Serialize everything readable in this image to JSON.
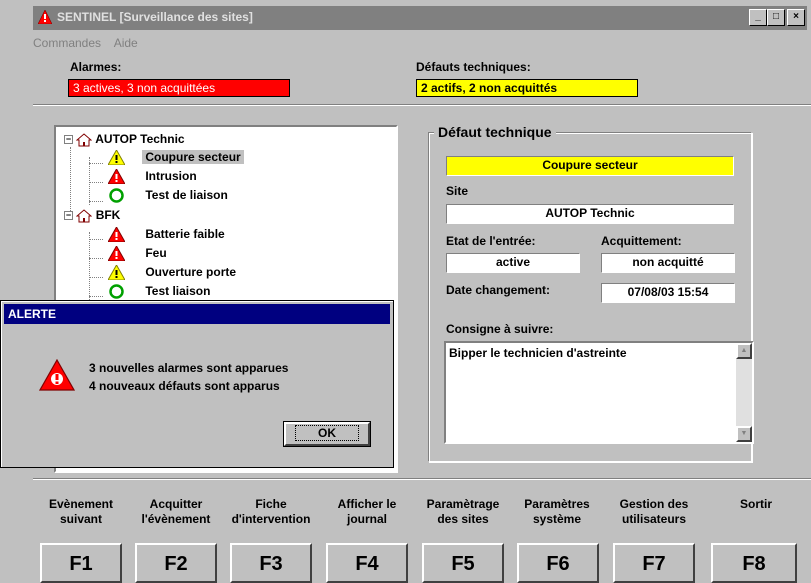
{
  "window": {
    "title": "SENTINEL [Surveillance des sites]",
    "minimize": "_",
    "maximize": "□",
    "close": "×"
  },
  "menu": {
    "commandes": "Commandes",
    "aide": "Aide"
  },
  "alarmes": {
    "label": "Alarmes:",
    "value": "3 actives, 3 non acquittées",
    "color": "#ff0000"
  },
  "defauts": {
    "label": "Défauts techniques:",
    "value": "2 actifs, 2 non acquittés",
    "color": "#ffff00"
  },
  "tree": {
    "sites": [
      {
        "name": "AUTOP Technic",
        "items": [
          {
            "label": "Coupure secteur",
            "icon": "warning-yellow-icon",
            "selected": true
          },
          {
            "label": "Intrusion",
            "icon": "alarm-red-icon"
          },
          {
            "label": "Test de liaison",
            "icon": "ok-green-circle-icon"
          }
        ]
      },
      {
        "name": "BFK",
        "items": [
          {
            "label": "Batterie faible",
            "icon": "alarm-red-icon"
          },
          {
            "label": "Feu",
            "icon": "alarm-red-icon"
          },
          {
            "label": "Ouverture porte",
            "icon": "warning-yellow-icon"
          },
          {
            "label": "Test liaison",
            "icon": "ok-green-circle-icon"
          }
        ]
      }
    ]
  },
  "detail": {
    "group_title": "Défaut technique",
    "header_value": "Coupure secteur",
    "site_label": "Site",
    "site_value": "AUTOP Technic",
    "etat_label": "Etat de l'entrée:",
    "etat_value": "active",
    "acq_label": "Acquittement:",
    "acq_value": "non acquitté",
    "date_label": "Date changement:",
    "date_value": "07/08/03 15:54",
    "consigne_label": "Consigne à suivre:",
    "consigne_value": "Bipper le technicien d'astreinte"
  },
  "dialog": {
    "title": "ALERTE",
    "line1": "3 nouvelles alarmes sont apparues",
    "line2": "4 nouveaux défauts sont apparus",
    "ok": "OK"
  },
  "fkeys": [
    {
      "key": "F1",
      "label1": "Evènement",
      "label2": "suivant"
    },
    {
      "key": "F2",
      "label1": "Acquitter",
      "label2": "l'évènement"
    },
    {
      "key": "F3",
      "label1": "Fiche",
      "label2": "d'intervention"
    },
    {
      "key": "F4",
      "label1": "Afficher le",
      "label2": "journal"
    },
    {
      "key": "F5",
      "label1": "Paramètrage",
      "label2": "des sites"
    },
    {
      "key": "F6",
      "label1": "Paramètres",
      "label2": "système"
    },
    {
      "key": "F7",
      "label1": "Gestion des",
      "label2": "utilisateurs"
    },
    {
      "key": "F8",
      "label1": "Sortir",
      "label2": ""
    }
  ]
}
